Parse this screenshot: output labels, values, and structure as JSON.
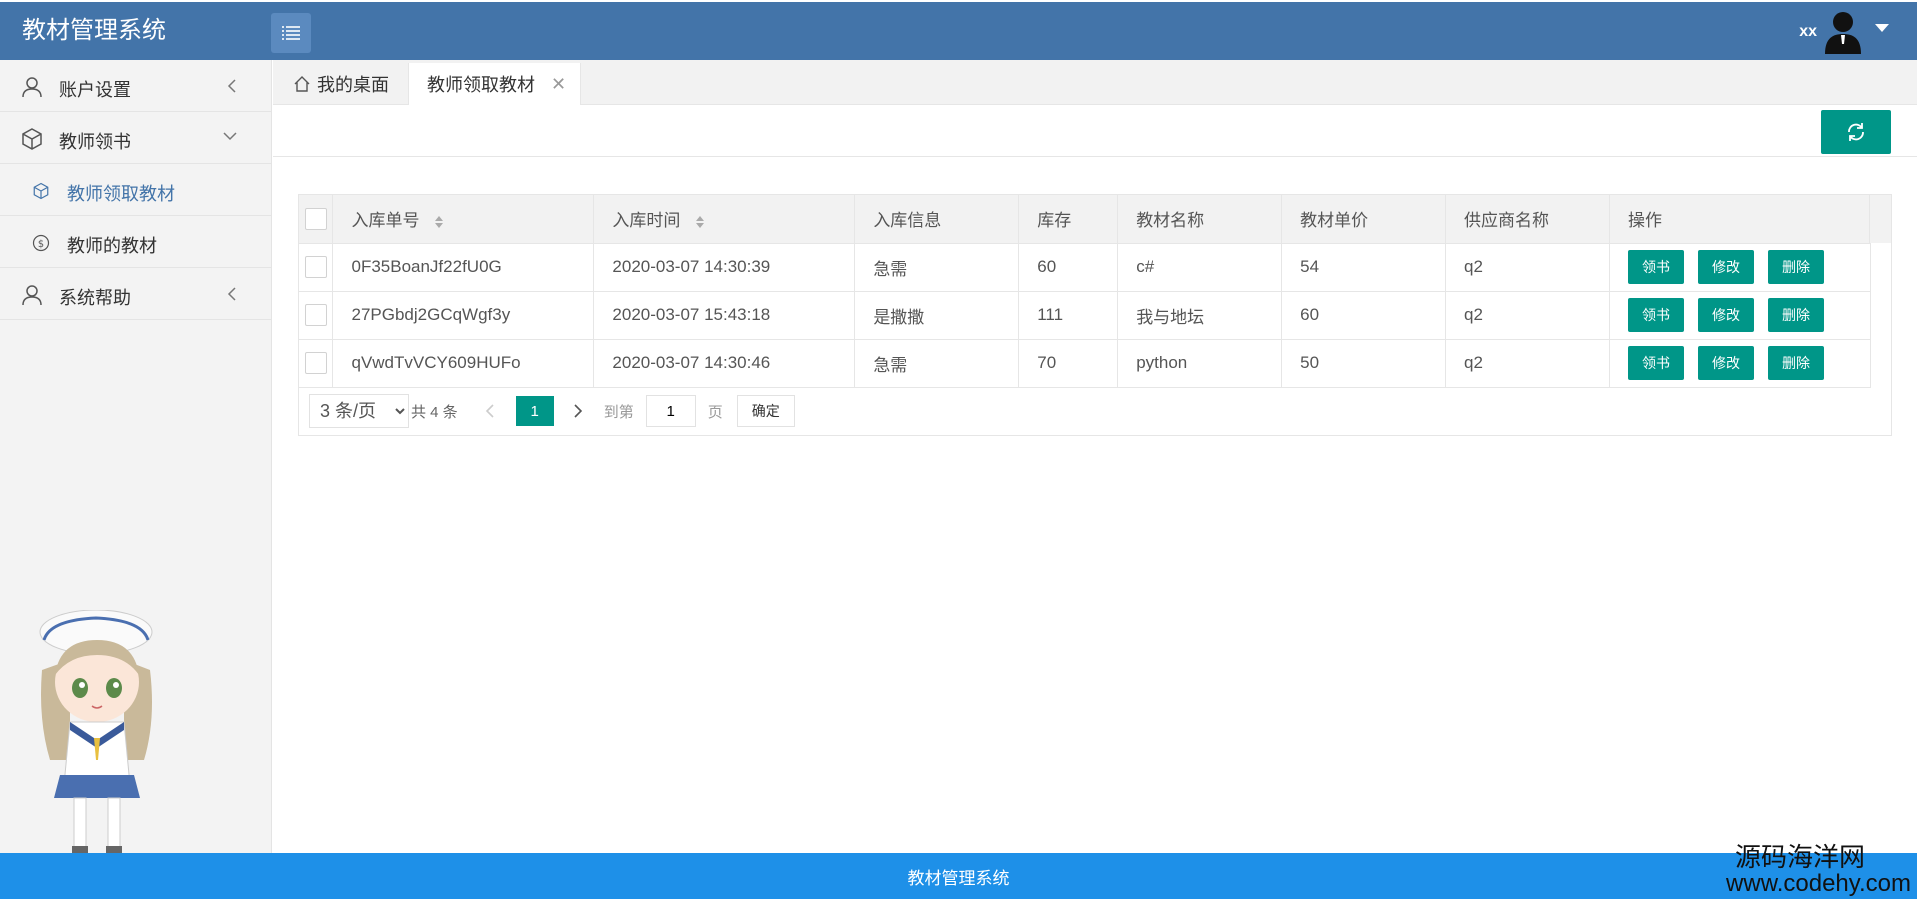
{
  "header": {
    "brand": "教材管理系统",
    "user_name": "xx"
  },
  "sidebar": {
    "items": [
      {
        "label": "账户设置"
      },
      {
        "label": "教师领书"
      },
      {
        "label": "系统帮助"
      }
    ],
    "sub_items": [
      {
        "label": "教师领取教材",
        "active": true
      },
      {
        "label": "教师的教材",
        "active": false
      }
    ]
  },
  "tabs": {
    "home": "我的桌面",
    "current": "教师领取教材",
    "close": "✕"
  },
  "table": {
    "columns": [
      "入库单号",
      "入库时间",
      "入库信息",
      "库存",
      "教材名称",
      "教材单价",
      "供应商名称",
      "操作"
    ],
    "rows": [
      {
        "id": "0F35BoanJf22fU0G",
        "time": "2020-03-07 14:30:39",
        "info": "急需",
        "stock": "60",
        "name": "c#",
        "price": "54",
        "supplier": "q2"
      },
      {
        "id": "27PGbdj2GCqWgf3y",
        "time": "2020-03-07 15:43:18",
        "info": "是撒撒",
        "stock": "111",
        "name": "我与地坛",
        "price": "60",
        "supplier": "q2"
      },
      {
        "id": "qVwdTvVCY609HUFo",
        "time": "2020-03-07 14:30:46",
        "info": "急需",
        "stock": "70",
        "name": "python",
        "price": "50",
        "supplier": "q2"
      }
    ],
    "actions": {
      "take": "领书",
      "edit": "修改",
      "delete": "删除"
    }
  },
  "pager": {
    "page_size": "3 条/页",
    "total": "共 4 条",
    "current_page": "1",
    "goto_label": "到第",
    "goto_value": "1",
    "page_unit": "页",
    "confirm": "确定"
  },
  "footer": {
    "text": "教材管理系统"
  },
  "watermark": {
    "line1": "源码海洋网",
    "line2": "www.codehy.com"
  },
  "colors": {
    "header": "#4374a9",
    "accent": "#009688",
    "footer": "#1e90e8",
    "active_text": "#4374a9"
  }
}
